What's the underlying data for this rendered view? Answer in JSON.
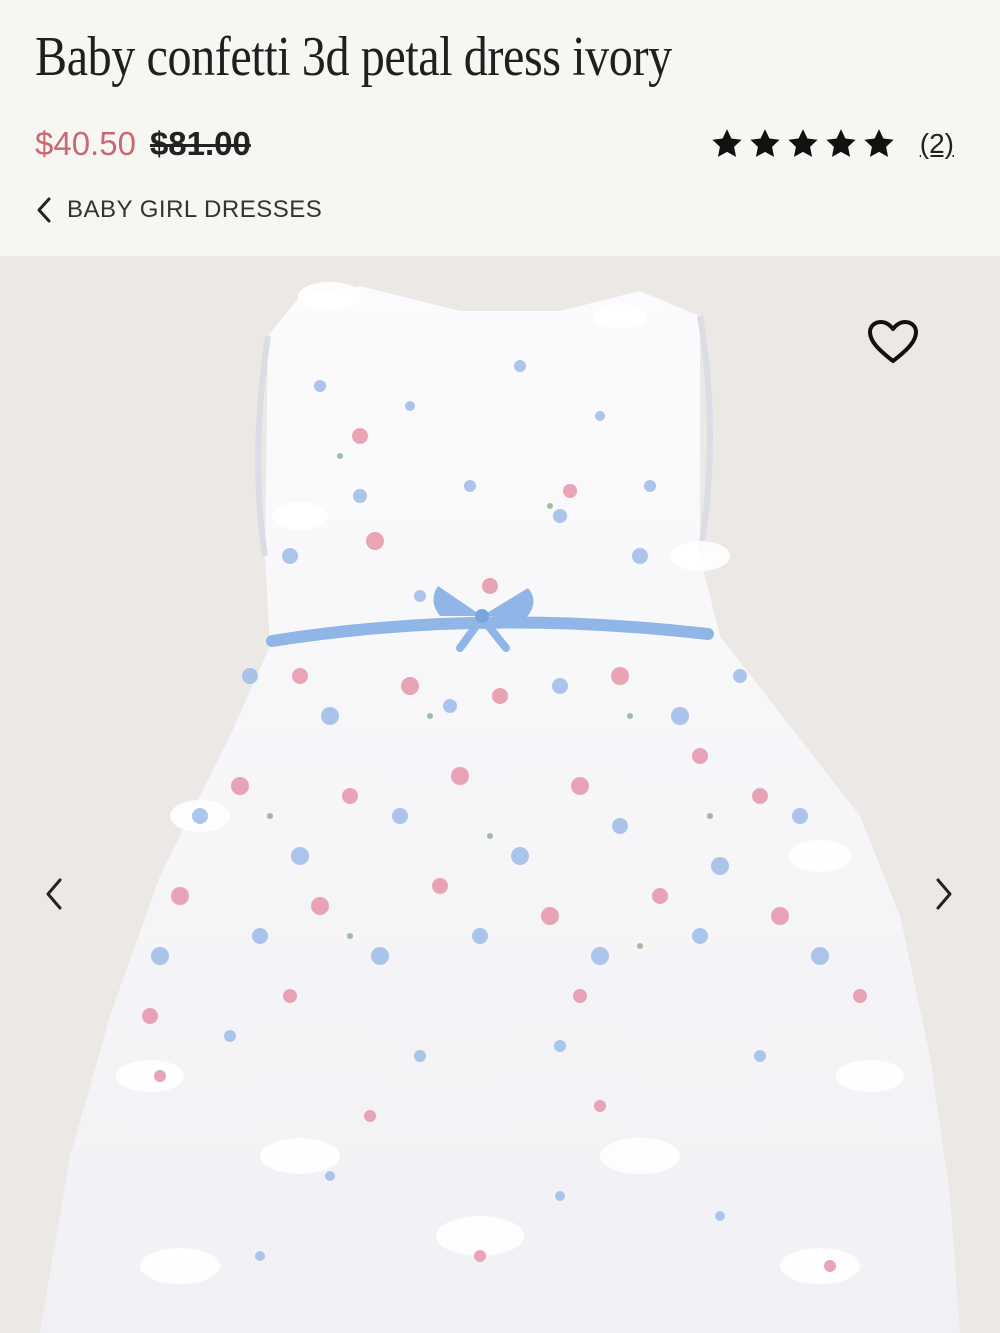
{
  "product": {
    "title": "Baby confetti 3d petal dress ivory",
    "sale_price": "$40.50",
    "original_price": "$81.00",
    "rating_stars": 5,
    "review_count": "(2)"
  },
  "breadcrumb": {
    "label": "BABY GIRL DRESSES",
    "icon": "chevron-left-icon"
  },
  "gallery": {
    "image_alt": "Ivory dress with blue and pink floral 3d petals and blue bow",
    "wishlist_icon": "heart-outline-icon",
    "prev_icon": "chevron-left-icon",
    "next_icon": "chevron-right-icon"
  },
  "colors": {
    "sale_price": "#c76a72",
    "background": "#f8f6f3",
    "gallery_bg": "#ebe8e5",
    "bow": "#8fb6e6"
  }
}
